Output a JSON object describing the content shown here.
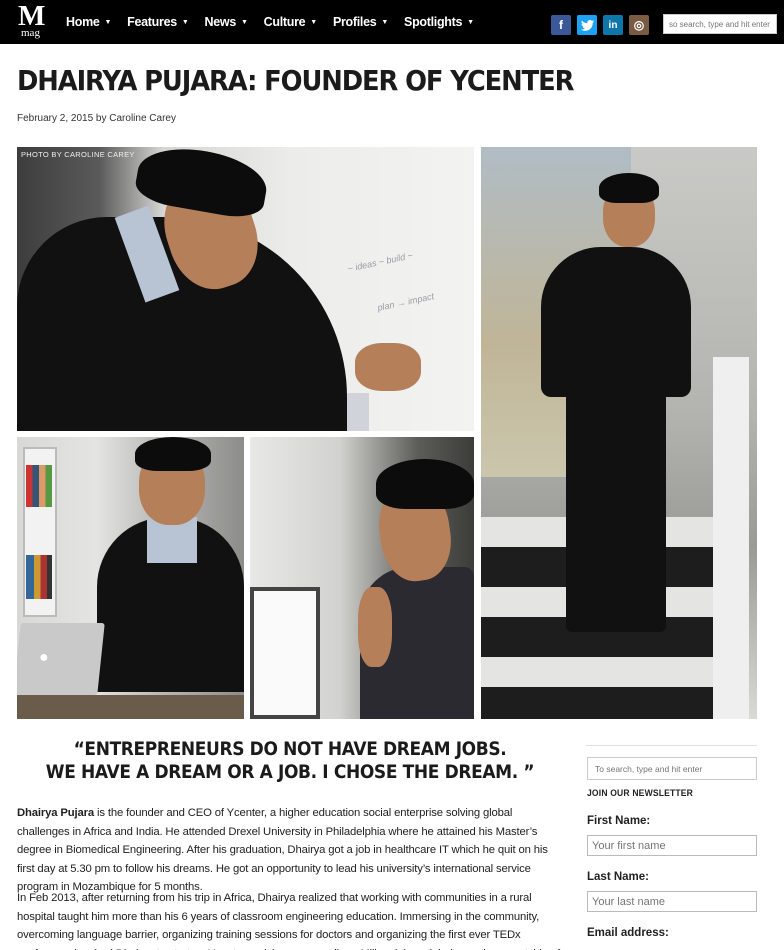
{
  "header": {
    "logo_letter": "M",
    "logo_sub": "mag",
    "nav": [
      {
        "label": "Home"
      },
      {
        "label": "Features"
      },
      {
        "label": "News"
      },
      {
        "label": "Culture"
      },
      {
        "label": "Profiles"
      },
      {
        "label": "Spotlights"
      }
    ],
    "social": [
      {
        "icon": "facebook-icon",
        "glyph": "f",
        "color": "#3b5998"
      },
      {
        "icon": "twitter-icon",
        "glyph": "t",
        "color": "#1da1f2"
      },
      {
        "icon": "linkedin-icon",
        "glyph": "in",
        "color": "#0e76a8"
      },
      {
        "icon": "instagram-icon",
        "glyph": "◎",
        "color": "#7a5c43"
      }
    ],
    "search_placeholder": "so search, type and hit enter"
  },
  "article": {
    "title": "DHAIRYA PUJARA: FOUNDER OF YCENTER",
    "byline": "February 2, 2015 by Caroline Carey",
    "photo_credit": "PHOTO BY CAROLINE CAREY",
    "quote_line1": "“ENTREPRENEURS DO NOT HAVE DREAM JOBS.",
    "quote_line2": "WE HAVE A DREAM OR A JOB. I CHOSE THE DREAM. ”",
    "para1_name": "Dhairya Pujara",
    "para1_rest": " is the founder and CEO of Ycenter, a higher education social enterprise solving global challenges in Africa and India. He attended Drexel University in Philadelphia where he attained his Master’s degree in Biomedical Engineering. After his graduation, Dhairya got a job in healthcare IT which he quit on his first day at 5.30 pm to follow his dreams. He got an opportunity to lead his university’s international service program in Mozambique for 5 months.",
    "para2": "In Feb 2013, after returning from his trip in Africa, Dhairya realized that working with communities in a rural hospital taught him more than his 6 years of classroom engineering education. Immersing in the community, overcoming language barrier, organizing training sessions for doctors and organizing the first ever TEDx conference inspired Dhairya to start up Ycenter – giving young college Millennials a global experience outside of the classroom while"
  },
  "sidebar": {
    "search_placeholder": "To search, type and hit enter",
    "newsletter_heading": "JOIN OUR NEWSLETTER",
    "first_name_label": "First Name:",
    "first_name_placeholder": "Your first name",
    "last_name_label": "Last Name:",
    "last_name_placeholder": "Your last name",
    "email_label": "Email address:"
  }
}
